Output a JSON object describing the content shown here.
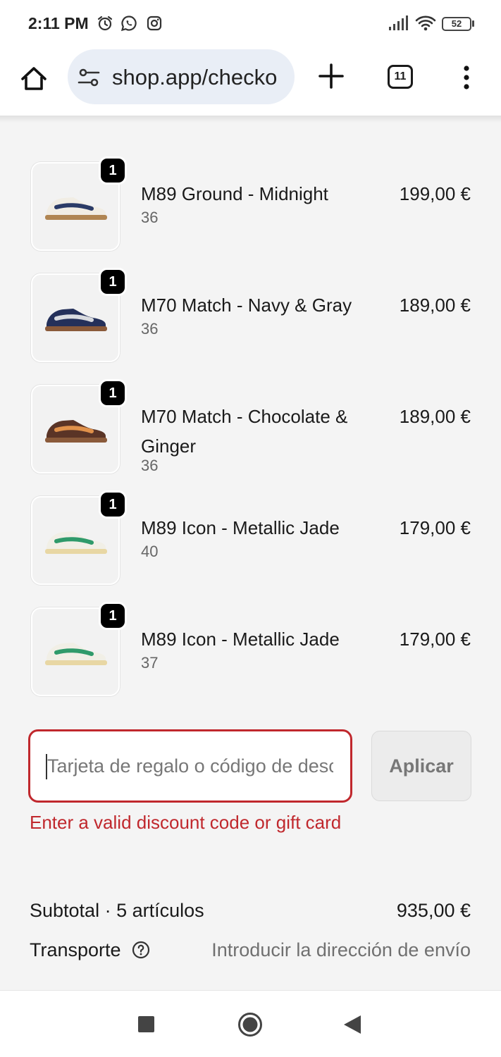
{
  "status_bar": {
    "time": "2:11 PM",
    "battery": "52",
    "icons": [
      "alarm-icon",
      "whatsapp-icon",
      "instagram-icon",
      "signal-icon",
      "wifi-icon",
      "battery-icon"
    ]
  },
  "browser": {
    "url": "shop.app/checko",
    "tab_count": "11",
    "icons": [
      "home-icon",
      "site-settings-icon",
      "new-tab-plus-icon",
      "tabs-icon",
      "more-vert-icon"
    ]
  },
  "items": [
    {
      "name": "M89 Ground - Midnight",
      "variant": "36",
      "price": "199,00 €",
      "quantity": "1",
      "shoe": {
        "upper": "#f1ede4",
        "accent": "#2b3b67",
        "sole": "#b08552"
      }
    },
    {
      "name": "M70 Match - Navy & Gray",
      "variant": "36",
      "price": "189,00 €",
      "quantity": "1",
      "shoe": {
        "upper": "#24305a",
        "accent": "#d9dbe0",
        "sole": "#8a5a3a"
      }
    },
    {
      "name": "M70 Match - Chocolate & Ginger",
      "variant": "36",
      "price": "189,00 €",
      "quantity": "1",
      "shoe": {
        "upper": "#5a3426",
        "accent": "#e0914a",
        "sole": "#8a5a3a"
      }
    },
    {
      "name": "M89 Icon - Metallic Jade",
      "variant": "40",
      "price": "179,00 €",
      "quantity": "1",
      "shoe": {
        "upper": "#f1efe6",
        "accent": "#2f9a6a",
        "sole": "#e8d7a4"
      }
    },
    {
      "name": "M89 Icon - Metallic Jade",
      "variant": "37",
      "price": "179,00 €",
      "quantity": "1",
      "shoe": {
        "upper": "#f1efe6",
        "accent": "#2f9a6a",
        "sole": "#e8d7a4"
      }
    }
  ],
  "discount": {
    "placeholder": "Tarjeta de regalo o código de descuento",
    "value": "",
    "apply_label": "Aplicar",
    "error": "Enter a valid discount code or gift card"
  },
  "totals": {
    "subtotal_label": "Subtotal · 5 artículos",
    "subtotal_value": "935,00 €",
    "shipping_label": "Transporte",
    "shipping_value": "Introducir la dirección de envío"
  },
  "colors": {
    "error": "#c0282d",
    "badge": "#000000",
    "url_bar": "#e9eef6",
    "background": "#f4f4f4"
  }
}
